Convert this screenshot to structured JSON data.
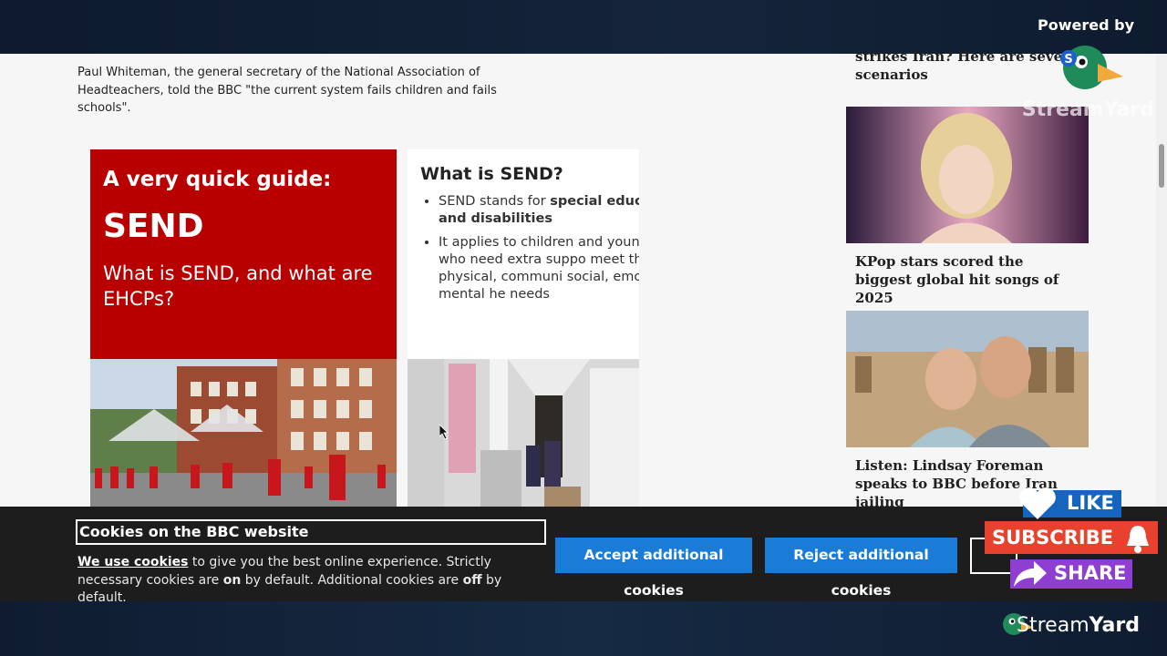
{
  "stream_overlay": {
    "powered_by": "Powered by",
    "streamyard_watermark": "StreamYard",
    "streamyard_logo_label": {
      "part1": "Stream",
      "part2": "Yard"
    },
    "like_label": "LIKE",
    "subscribe_label": "SUBSCRIBE",
    "share_label": "SHARE"
  },
  "article": {
    "lead_paragraph": "Paul Whiteman, the general secretary of the National Association of Headteachers, told the BBC \"the current system fails children and fails schools\".",
    "guide_card": {
      "kicker": "A very quick guide:",
      "title": "SEND",
      "subtitle": "What is SEND, and what are EHCPs?"
    },
    "info_card": {
      "heading": "What is SEND?",
      "bullet1_pre": "SEND stands for ",
      "bullet1_bold": "special educ needs and disabilities",
      "bullet2": "It applies to children and youn people who need extra suppo meet their physical, communi social, emotional or mental he needs"
    }
  },
  "sidebar": {
    "items": [
      {
        "title": "strikes Iran? Here are seven scenarios"
      },
      {
        "title": "KPop stars scored the biggest global hit songs of 2025"
      },
      {
        "title": "Listen: Lindsay Foreman speaks to BBC before Iran jailing"
      }
    ]
  },
  "cookie_banner": {
    "title": "Cookies on the BBC website",
    "link_text": "We use cookies",
    "text_1": " to give you the best online experience. Strictly necessary cookies are ",
    "on_word": "on",
    "text_2": " by default. Additional cookies are ",
    "off_word": "off",
    "text_3": " by default.",
    "accept_label": "Accept additional cookies",
    "reject_label": "Reject additional cookies"
  },
  "colors": {
    "bbc_red": "#b80000",
    "button_blue": "#1a7cd6",
    "cookie_bg": "#1d1d1d",
    "like_blue": "#1565c0",
    "subscribe_red": "#e8412e",
    "share_purple": "#8e3fd1"
  },
  "icons": [
    "streamyard-duck-icon",
    "heart-icon",
    "bell-icon",
    "share-arrow-icon",
    "mouse-cursor-icon"
  ]
}
